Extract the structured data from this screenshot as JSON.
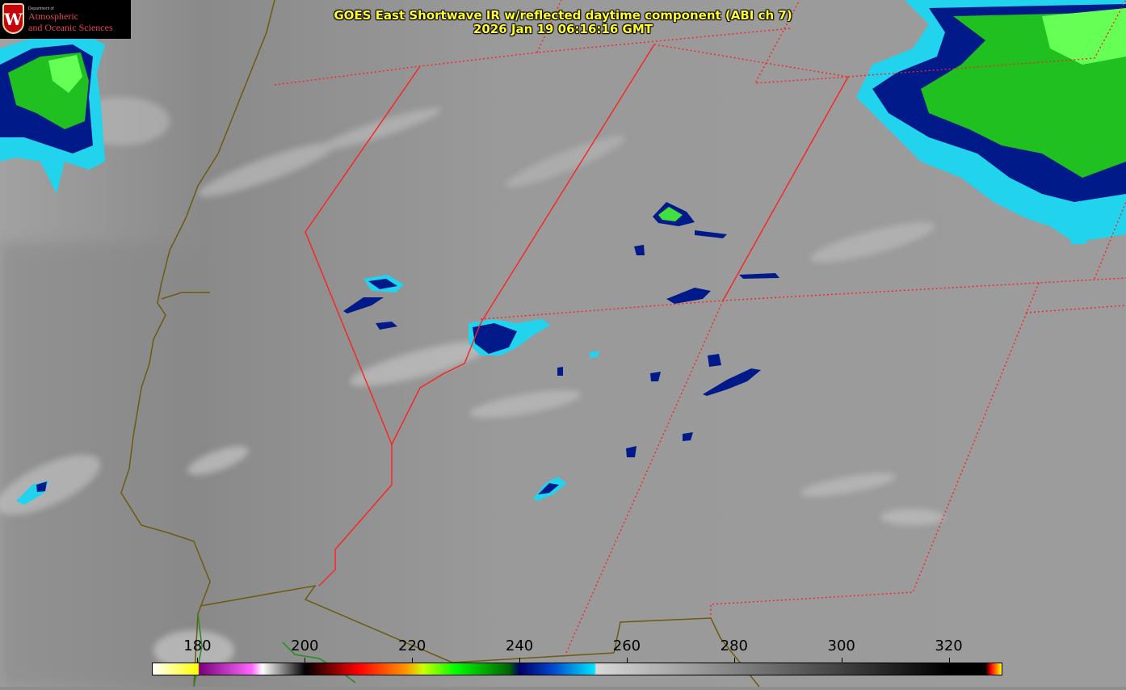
{
  "title": {
    "line1": "GOES East Shortwave IR w/reflected daytime component (ABI ch 7)",
    "line2": "2026 Jan 19 06:16:16 GMT"
  },
  "logo": {
    "crest_letter": "W",
    "department": "Department of",
    "line1": "Atmospheric",
    "line2": "and Oceanic Sciences"
  },
  "colorbar": {
    "min": 171.5,
    "max": 330,
    "ticks": [
      "180",
      "200",
      "220",
      "240",
      "260",
      "280",
      "300",
      "320"
    ],
    "colors": {
      "white": "#ffffff",
      "yellow": "#ffff00",
      "purple": "#7a007a",
      "magenta": "#ff66ff",
      "black": "#000000",
      "red": "#ff0000",
      "orange": "#ff9900",
      "green": "#00ff00",
      "dark_blue": "#000066",
      "cyan": "#00e5ff"
    }
  },
  "map": {
    "colors": {
      "background": "#8e8e8e",
      "state_boundary": "#ff2020",
      "coastline": "#6b5a10",
      "cold_cloud_cyan": "#22d3ee",
      "cold_cloud_blue": "#001a8a",
      "cold_cloud_green": "#20c020"
    }
  }
}
